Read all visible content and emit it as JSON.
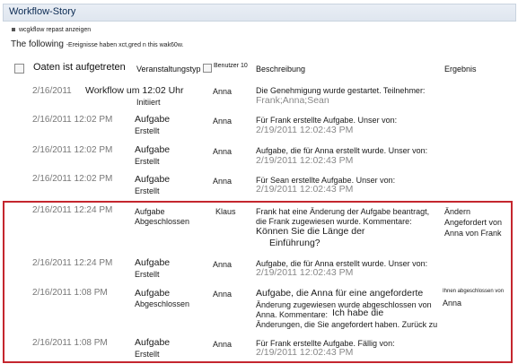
{
  "title": "Workflow-Story",
  "show_link": "wcgkflow repast anzeigen",
  "summary": {
    "prefix": "The following",
    "rest": "-Ereignisse haben xct,gred n this wak60w."
  },
  "columns": {
    "date": "Oaten ist aufgetreten",
    "type": "Veranstaltungstyp",
    "user": "Benutzer 10",
    "desc": "Beschreibung",
    "result": "Ergebnis"
  },
  "rows": [
    {
      "date": "2/16/2011",
      "type_line1": "Workflow um 12:02 Uhr",
      "type_line2": "Initiiert",
      "user": "Anna",
      "desc_line1": "Die Genehmigung wurde gestartet. Teilnehmer:",
      "desc_line2": "Frank;Anna;Sean",
      "desc_line3": "",
      "desc_line4": "",
      "result_line1": "",
      "result_line2": "",
      "result_line3": ""
    },
    {
      "date": "2/16/2011 12:02 PM",
      "type_line1": "Aufgabe",
      "type_line2": "Erstellt",
      "user": "Anna",
      "desc_line1": "Für Frank erstellte Aufgabe. Unser von:",
      "desc_line2": "2/19/2011 12:02:43 PM",
      "desc_line3": "",
      "desc_line4": "",
      "result_line1": "",
      "result_line2": "",
      "result_line3": ""
    },
    {
      "date": "2/16/2011 12:02 PM",
      "type_line1": "Aufgabe",
      "type_line2": "Erstellt",
      "user": "Anna",
      "desc_line1": "Aufgabe, die für Anna erstellt wurde. Unser von:",
      "desc_line2": "2/19/2011 12:02:43 PM",
      "desc_line3": "",
      "desc_line4": "",
      "result_line1": "",
      "result_line2": "",
      "result_line3": ""
    },
    {
      "date": "2/16/2011 12:02 PM",
      "type_line1": "Aufgabe",
      "type_line2": "Erstellt",
      "user": "Anna",
      "desc_line1": "Für Sean erstellte Aufgabe. Unser von:",
      "desc_line2": "2/19/2011 12:02:43 PM",
      "desc_line3": "",
      "desc_line4": "",
      "result_line1": "",
      "result_line2": "",
      "result_line3": ""
    },
    {
      "date": "2/16/2011 12:24 PM",
      "type_line1": "Aufgabe",
      "type_line2": "Abgeschlossen",
      "user": "Klaus",
      "desc_line1": "Frank hat eine Änderung der Aufgabe beantragt,",
      "desc_line2": "die Frank zugewiesen wurde. Kommentare:",
      "desc_line3": "Können Sie die Länge der",
      "desc_line4": "Einführung?",
      "result_line1": "Ändern",
      "result_line2": "Angefordert von",
      "result_line3": "Anna von Frank"
    },
    {
      "date": "2/16/2011 12:24 PM",
      "type_line1": "Aufgabe",
      "type_line2": "Erstellt",
      "user": "Anna",
      "desc_line1": "Aufgabe, die für Anna erstellt wurde. Unser von:",
      "desc_line2": "2/19/2011 12:02:43 PM",
      "desc_line3": "",
      "desc_line4": "",
      "result_line1": "",
      "result_line2": "",
      "result_line3": ""
    },
    {
      "date": "2/16/2011 1:08 PM",
      "type_line1": "Aufgabe",
      "type_line2": "Abgeschlossen",
      "user": "Anna",
      "desc_line1": "Aufgabe, die Anna für eine angeforderte",
      "desc_line2": "Änderung zugewiesen wurde abgeschlossen von",
      "desc_line3": "Anna. Kommentare:",
      "desc_line3b": "Ich habe die",
      "desc_line4": "Änderungen, die Sie angefordert haben. Zurück zu",
      "result_line1": "Ihnen abgeschlossen von",
      "result_line2": "Anna",
      "result_line3": ""
    },
    {
      "date": "2/16/2011 1:08 PM",
      "type_line1": "Aufgabe",
      "type_line2": "Erstellt",
      "user": "Anna",
      "desc_line1": "Für Frank erstellte Aufgabe. Fällig von:",
      "desc_line2": "2/19/2011 12:02:43 PM",
      "desc_line3": "",
      "desc_line4": "",
      "result_line1": "",
      "result_line2": "",
      "result_line3": ""
    }
  ],
  "colors": {
    "selection_border": "#c4262e",
    "title_bg": "#e3e9f1"
  }
}
